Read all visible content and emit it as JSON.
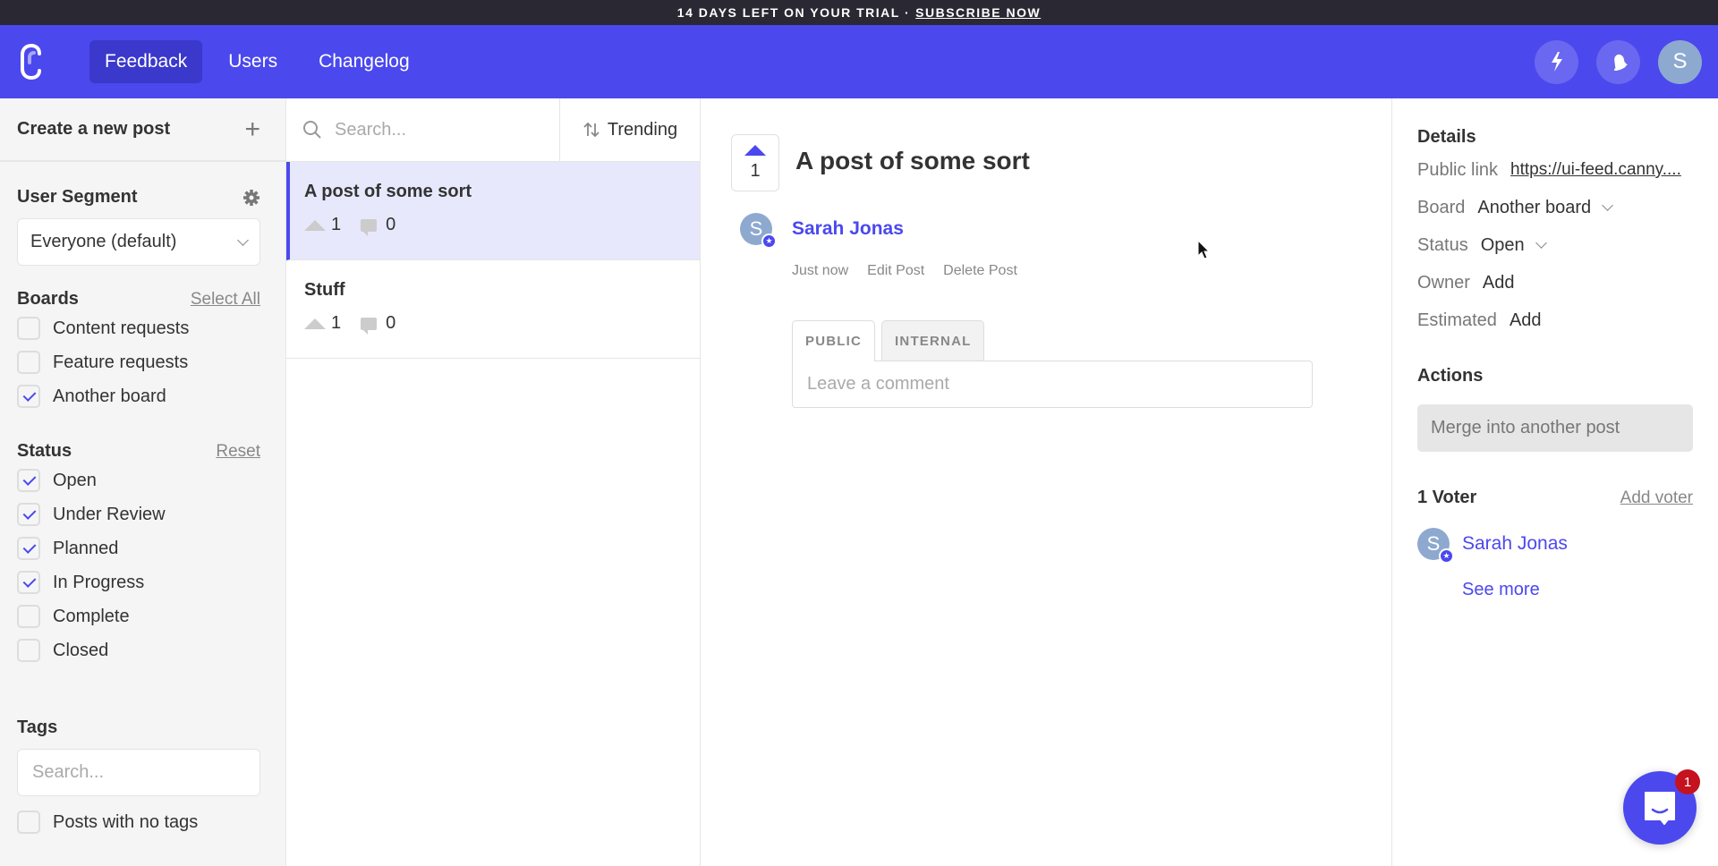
{
  "trial_bar": {
    "message": "14 DAYS LEFT ON YOUR TRIAL ·",
    "cta": "SUBSCRIBE NOW"
  },
  "nav": {
    "items": [
      {
        "label": "Feedback",
        "active": true
      },
      {
        "label": "Users",
        "active": false
      },
      {
        "label": "Changelog",
        "active": false
      }
    ],
    "avatar_initial": "S",
    "icons": [
      "lightning-icon",
      "bell-icon",
      "avatar"
    ]
  },
  "sidebar": {
    "create_post_label": "Create a new post",
    "user_segment": {
      "title": "User Segment",
      "selected": "Everyone (default)"
    },
    "boards": {
      "title": "Boards",
      "action": "Select All",
      "items": [
        {
          "label": "Content requests",
          "checked": false
        },
        {
          "label": "Feature requests",
          "checked": false
        },
        {
          "label": "Another board",
          "checked": true
        }
      ]
    },
    "status": {
      "title": "Status",
      "action": "Reset",
      "items": [
        {
          "label": "Open",
          "checked": true
        },
        {
          "label": "Under Review",
          "checked": true
        },
        {
          "label": "Planned",
          "checked": true
        },
        {
          "label": "In Progress",
          "checked": true
        },
        {
          "label": "Complete",
          "checked": false
        },
        {
          "label": "Closed",
          "checked": false
        }
      ]
    },
    "tags": {
      "title": "Tags",
      "search_placeholder": "Search...",
      "no_tags_label": "Posts with no tags",
      "no_tags_checked": false
    }
  },
  "post_list": {
    "search_placeholder": "Search...",
    "sort_label": "Trending",
    "posts": [
      {
        "title": "A post of some sort",
        "votes": "1",
        "comments": "0",
        "active": true
      },
      {
        "title": "Stuff",
        "votes": "1",
        "comments": "0",
        "active": false
      }
    ]
  },
  "post_detail": {
    "votes": "1",
    "title": "A post of some sort",
    "author": {
      "name": "Sarah Jonas",
      "initial": "S"
    },
    "time": "Just now",
    "edit_label": "Edit Post",
    "delete_label": "Delete Post",
    "comment_tabs": [
      {
        "label": "PUBLIC",
        "active": true
      },
      {
        "label": "INTERNAL",
        "active": false
      }
    ],
    "comment_placeholder": "Leave a comment"
  },
  "details_panel": {
    "title": "Details",
    "public_link_label": "Public link",
    "public_link_value": "https://ui-feed.canny....",
    "board_label": "Board",
    "board_value": "Another board",
    "status_label": "Status",
    "status_value": "Open",
    "owner_label": "Owner",
    "owner_value": "Add",
    "estimated_label": "Estimated",
    "estimated_value": "Add",
    "actions_title": "Actions",
    "merge_label": "Merge into another post",
    "voters_title": "1 Voter",
    "add_voter_label": "Add voter",
    "voters": [
      {
        "name": "Sarah Jonas",
        "initial": "S"
      }
    ],
    "see_more_label": "See more"
  },
  "chat": {
    "badge_count": "1"
  },
  "colors": {
    "brand": "#4b48ee",
    "trial_bar": "#2a2832",
    "active_post_bg": "#e7e8fb",
    "badge": "#c4121f"
  }
}
